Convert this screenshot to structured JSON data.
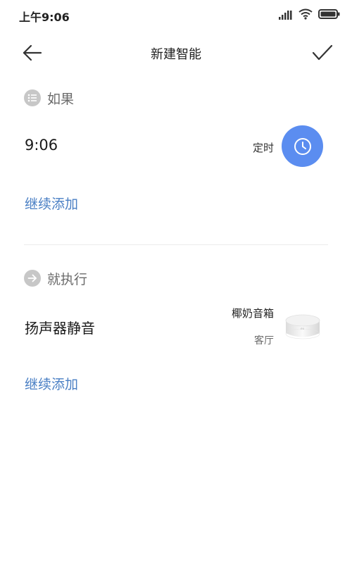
{
  "status_bar": {
    "time": "上午9:06"
  },
  "header": {
    "title": "新建智能"
  },
  "if_section": {
    "label": "如果",
    "condition": {
      "time": "9:06",
      "type": "定时"
    },
    "add_label": "继续添加"
  },
  "then_section": {
    "label": "就执行",
    "action": {
      "label": "扬声器静音",
      "device_name": "椰奶音箱",
      "room": "客厅"
    },
    "add_label": "继续添加"
  },
  "colors": {
    "accent_blue": "#5b8df0",
    "link_blue": "#4a7fc4",
    "section_icon_gray": "#c7c7c7"
  },
  "icons": {
    "back": "arrow-left-icon",
    "confirm": "checkmark-icon",
    "if_section": "list-icon",
    "then_section": "arrow-right-circle-icon",
    "condition": "clock-icon"
  }
}
